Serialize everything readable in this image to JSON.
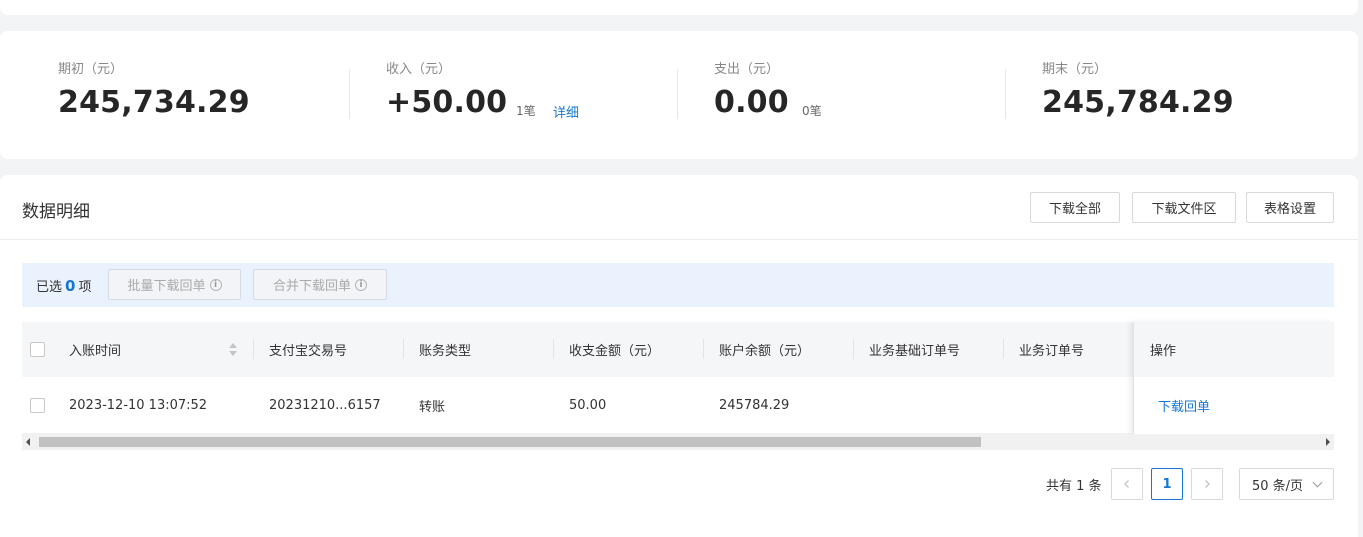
{
  "summary": {
    "opening": {
      "label": "期初（元）",
      "value": "245,734.29"
    },
    "income": {
      "label": "收入（元）",
      "value": "+50.00",
      "count": "1笔",
      "detail": "详细"
    },
    "expense": {
      "label": "支出（元）",
      "value": "0.00",
      "count": "0笔"
    },
    "closing": {
      "label": "期末（元）",
      "value": "245,784.29"
    }
  },
  "panel": {
    "title": "数据明细",
    "buttons": {
      "download_all": "下载全部",
      "download_area": "下载文件区",
      "table_settings": "表格设置"
    }
  },
  "selection": {
    "prefix": "已选",
    "count": "0",
    "suffix": "项",
    "batch_download": "批量下载回单",
    "merge_download": "合并下载回单"
  },
  "table": {
    "headers": [
      "入账时间",
      "支付宝交易号",
      "账务类型",
      "收支金额（元）",
      "账户余额（元）",
      "业务基础订单号",
      "业务订单号",
      "操作"
    ],
    "rows": [
      {
        "time": "2023-12-10 13:07:52",
        "trade_no": "20231210...6157",
        "type": "转账",
        "amount": "50.00",
        "balance": "245784.29",
        "base_order": "",
        "order": "",
        "action": "下载回单"
      }
    ]
  },
  "pagination": {
    "total": "共有 1 条",
    "current_page": "1",
    "page_size": "50 条/页"
  },
  "colors": {
    "accent": "#1677d2",
    "select_bar": "#eaf2fe"
  }
}
